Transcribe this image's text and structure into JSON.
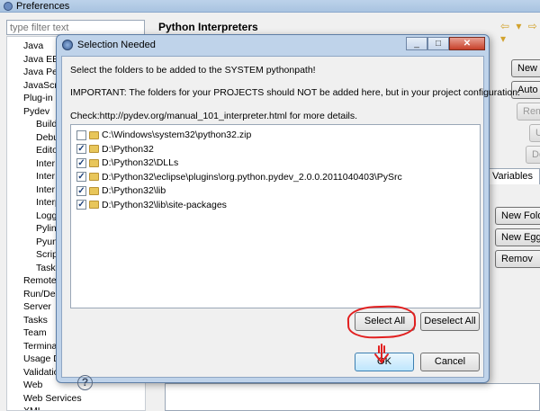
{
  "preferences": {
    "title": "Preferences",
    "filter_placeholder": "type filter text",
    "tree_items": [
      {
        "label": "Java",
        "indent": 0
      },
      {
        "label": "Java EE",
        "indent": 0
      },
      {
        "label": "Java Per",
        "indent": 0
      },
      {
        "label": "JavaScri",
        "indent": 0
      },
      {
        "label": "Plug-in D",
        "indent": 0
      },
      {
        "label": "Pydev",
        "indent": 0
      },
      {
        "label": "Build",
        "indent": 1
      },
      {
        "label": "Debu",
        "indent": 1
      },
      {
        "label": "Edito",
        "indent": 1
      },
      {
        "label": "Inter",
        "indent": 1
      },
      {
        "label": "Inter",
        "indent": 1
      },
      {
        "label": "Inter",
        "indent": 1
      },
      {
        "label": "Interp",
        "indent": 1
      },
      {
        "label": "Logg",
        "indent": 1
      },
      {
        "label": "Pylint",
        "indent": 1
      },
      {
        "label": "Pyuni",
        "indent": 1
      },
      {
        "label": "Scrip",
        "indent": 1
      },
      {
        "label": "Task",
        "indent": 1
      },
      {
        "label": "Remote",
        "indent": 0
      },
      {
        "label": "Run/Deb",
        "indent": 0
      },
      {
        "label": "Server",
        "indent": 0
      },
      {
        "label": "Tasks",
        "indent": 0
      },
      {
        "label": "Team",
        "indent": 0
      },
      {
        "label": "Termina",
        "indent": 0
      },
      {
        "label": "Usage D",
        "indent": 0
      },
      {
        "label": "Validatio",
        "indent": 0
      },
      {
        "label": "Web",
        "indent": 0
      },
      {
        "label": "Web Services",
        "indent": 0
      },
      {
        "label": "XML",
        "indent": 0
      }
    ],
    "right_title": "Python Interpreters",
    "side_buttons": [
      "New",
      "Auto C",
      "Remo",
      "Up",
      "Dow"
    ],
    "variables_tab": "Variables",
    "lib_buttons": [
      "New Fold",
      "New Egg/Z",
      "Remov"
    ]
  },
  "dialog": {
    "title": "Selection Needed",
    "message1": "Select the folders to be added to the SYSTEM pythonpath!",
    "message2": "IMPORTANT: The folders for your PROJECTS should NOT be added here, but in your project configuration.",
    "message3": "Check:http://pydev.org/manual_101_interpreter.html for more details.",
    "folders": [
      {
        "path": "C:\\Windows\\system32\\python32.zip",
        "checked": false
      },
      {
        "path": "D:\\Python32",
        "checked": true
      },
      {
        "path": "D:\\Python32\\DLLs",
        "checked": true
      },
      {
        "path": "D:\\Python32\\eclipse\\plugins\\org.python.pydev_2.0.0.2011040403\\PySrc",
        "checked": true
      },
      {
        "path": "D:\\Python32\\lib",
        "checked": true
      },
      {
        "path": "D:\\Python32\\lib\\site-packages",
        "checked": true
      }
    ],
    "select_all_label": "Select All",
    "deselect_all_label": "Deselect All",
    "ok_label": "OK",
    "cancel_label": "Cancel"
  },
  "colors": {
    "annotation": "#e21f1f",
    "default_button": "#bee6fd"
  }
}
